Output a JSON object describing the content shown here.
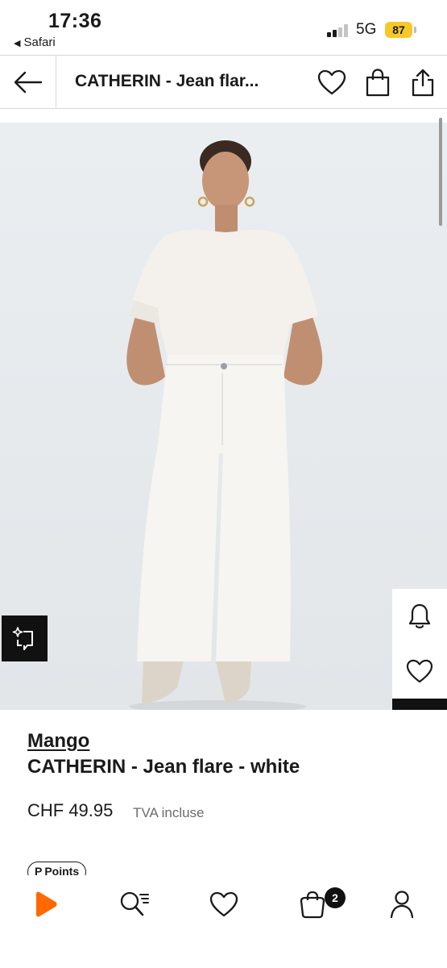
{
  "status_bar": {
    "time": "17:36",
    "back_app": "Safari",
    "network": "5G",
    "battery": "87",
    "battery_color": "#f7c928"
  },
  "header": {
    "title": "CATHERIN - Jean flar...",
    "back_icon": "arrow-left-icon",
    "icons": [
      "heart-icon",
      "bag-icon",
      "share-icon"
    ]
  },
  "product": {
    "brand": "Mango",
    "name": "CATHERIN - Jean flare - white",
    "price": "CHF 49.95",
    "vat_note": "TVA incluse",
    "points_label": "Points",
    "image_background": "#e9edf0"
  },
  "side_actions": [
    "bell-icon",
    "heart-icon"
  ],
  "bottom_nav": {
    "items": [
      "home-logo-icon",
      "search-icon",
      "heart-icon",
      "bag-icon",
      "profile-icon"
    ],
    "cart_count": "2",
    "brand_color": "#ff6900"
  }
}
